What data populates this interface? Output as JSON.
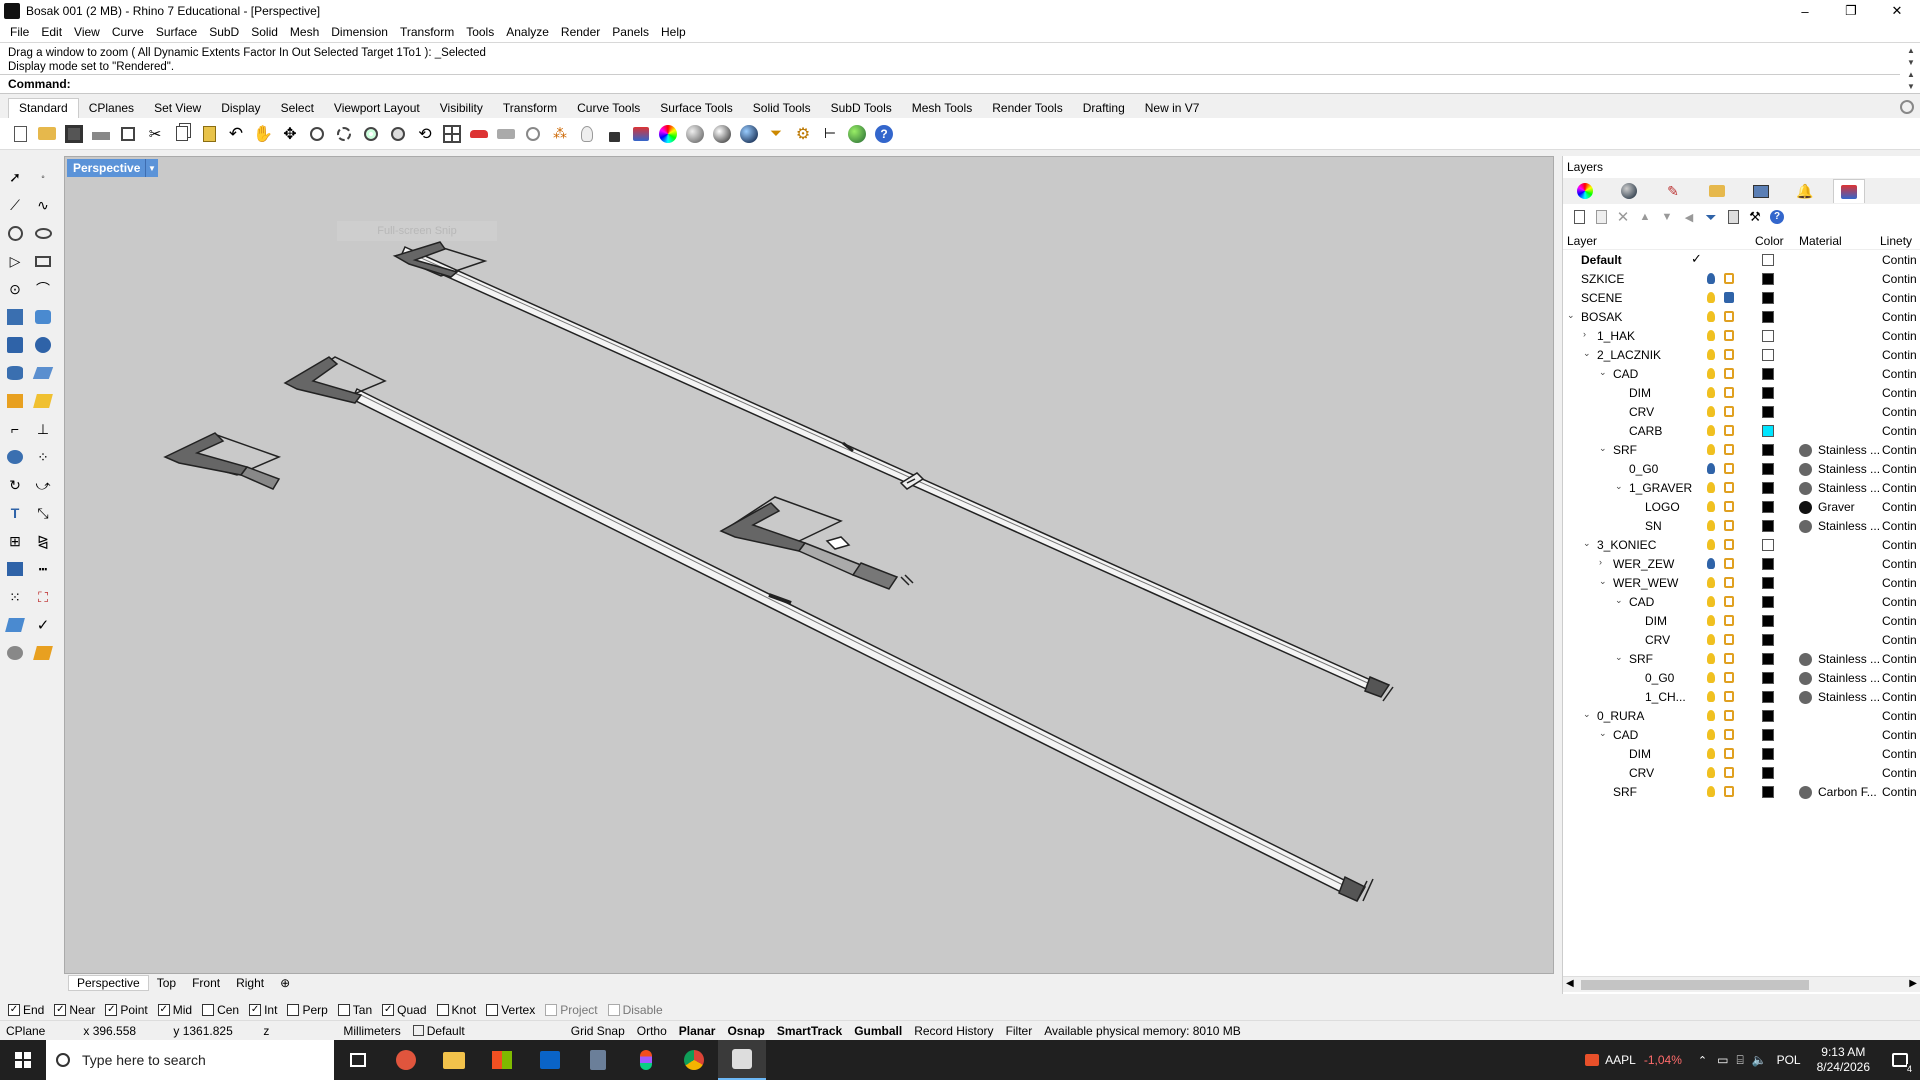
{
  "window": {
    "title": "Bosak 001 (2 MB) - Rhino 7 Educational - [Perspective]",
    "minimize": "–",
    "maximize": "❐",
    "close": "✕"
  },
  "menu": [
    "File",
    "Edit",
    "View",
    "Curve",
    "Surface",
    "SubD",
    "Solid",
    "Mesh",
    "Dimension",
    "Transform",
    "Tools",
    "Analyze",
    "Render",
    "Panels",
    "Help"
  ],
  "command": {
    "history_1": "Drag a window to zoom ( All  Dynamic  Extents  Factor  In  Out  Selected  Target  1To1 ): _Selected",
    "history_2": "Display mode set to \"Rendered\".",
    "prompt": "Command:",
    "value": ""
  },
  "toolbar_tabs": [
    "Standard",
    "CPlanes",
    "Set View",
    "Display",
    "Select",
    "Viewport Layout",
    "Visibility",
    "Transform",
    "Curve Tools",
    "Surface Tools",
    "Solid Tools",
    "SubD Tools",
    "Mesh Tools",
    "Render Tools",
    "Drafting",
    "New in V7"
  ],
  "viewport": {
    "name": "Perspective",
    "overlay_text": "Full-screen Snip"
  },
  "viewport_tabs": [
    "Perspective",
    "Top",
    "Front",
    "Right",
    "⊕"
  ],
  "osnaps": [
    {
      "label": "End",
      "checked": true
    },
    {
      "label": "Near",
      "checked": true
    },
    {
      "label": "Point",
      "checked": true
    },
    {
      "label": "Mid",
      "checked": true
    },
    {
      "label": "Cen",
      "checked": false
    },
    {
      "label": "Int",
      "checked": true
    },
    {
      "label": "Perp",
      "checked": false
    },
    {
      "label": "Tan",
      "checked": false
    },
    {
      "label": "Quad",
      "checked": true
    },
    {
      "label": "Knot",
      "checked": false
    },
    {
      "label": "Vertex",
      "checked": false
    },
    {
      "label": "Project",
      "checked": false,
      "dim": true
    },
    {
      "label": "Disable",
      "checked": false,
      "dim": true
    }
  ],
  "status": {
    "cplane": "CPlane",
    "x": "x 396.558",
    "y": "y 1361.825",
    "z": "z",
    "units": "Millimeters",
    "layer": "Default",
    "grid_snap": "Grid Snap",
    "ortho": "Ortho",
    "planar": "Planar",
    "osnap": "Osnap",
    "smarttrack": "SmartTrack",
    "gumball": "Gumball",
    "record_history": "Record History",
    "filter": "Filter",
    "memory": "Available physical memory: 8010 MB"
  },
  "layers_panel": {
    "title": "Layers",
    "headers": {
      "layer": "Layer",
      "color": "Color",
      "material": "Material",
      "linetype": "Linety"
    },
    "rows": [
      {
        "name": "Default",
        "indent": 0,
        "arrow": "",
        "bold": true,
        "current": true,
        "color": "#ffffff",
        "material": "",
        "matcolor": "",
        "linetype": "Contin"
      },
      {
        "name": "SZKICE",
        "indent": 0,
        "arrow": "",
        "color": "#000000",
        "material": "",
        "matcolor": "",
        "linetype": "Contin",
        "bulb": "blue"
      },
      {
        "name": "SCENE",
        "indent": 0,
        "arrow": "",
        "color": "#000000",
        "material": "",
        "matcolor": "",
        "linetype": "Contin",
        "lock": "locked"
      },
      {
        "name": "BOSAK",
        "indent": 0,
        "arrow": "down",
        "color": "#000000",
        "material": "",
        "matcolor": "",
        "linetype": "Contin"
      },
      {
        "name": "1_HAK",
        "indent": 1,
        "arrow": "right",
        "color": "#ffffff",
        "material": "",
        "matcolor": "",
        "linetype": "Contin"
      },
      {
        "name": "2_LACZNIK",
        "indent": 1,
        "arrow": "down",
        "color": "#ffffff",
        "material": "",
        "matcolor": "",
        "linetype": "Contin"
      },
      {
        "name": "CAD",
        "indent": 2,
        "arrow": "down",
        "color": "#000000",
        "material": "",
        "matcolor": "",
        "linetype": "Contin"
      },
      {
        "name": "DIM",
        "indent": 3,
        "arrow": "",
        "color": "#000000",
        "material": "",
        "matcolor": "",
        "linetype": "Contin"
      },
      {
        "name": "CRV",
        "indent": 3,
        "arrow": "",
        "color": "#000000",
        "material": "",
        "matcolor": "",
        "linetype": "Contin"
      },
      {
        "name": "CARB",
        "indent": 3,
        "arrow": "",
        "color": "#00e5ff",
        "material": "",
        "matcolor": "",
        "linetype": "Contin"
      },
      {
        "name": "SRF",
        "indent": 2,
        "arrow": "down",
        "color": "#000000",
        "material": "Stainless ...",
        "matcolor": "#666666",
        "linetype": "Contin"
      },
      {
        "name": "0_G0",
        "indent": 3,
        "arrow": "",
        "color": "#000000",
        "material": "Stainless ...",
        "matcolor": "#666666",
        "linetype": "Contin",
        "bulb": "blue"
      },
      {
        "name": "1_GRAVER",
        "indent": 3,
        "arrow": "down",
        "color": "#000000",
        "material": "Stainless ...",
        "matcolor": "#666666",
        "linetype": "Contin"
      },
      {
        "name": "LOGO",
        "indent": 4,
        "arrow": "",
        "color": "#000000",
        "material": "Graver",
        "matcolor": "#111111",
        "linetype": "Contin"
      },
      {
        "name": "SN",
        "indent": 4,
        "arrow": "",
        "color": "#000000",
        "material": "Stainless ...",
        "matcolor": "#666666",
        "linetype": "Contin"
      },
      {
        "name": "3_KONIEC",
        "indent": 1,
        "arrow": "down",
        "color": "#ffffff",
        "material": "",
        "matcolor": "",
        "linetype": "Contin"
      },
      {
        "name": "WER_ZEW",
        "indent": 2,
        "arrow": "right",
        "color": "#000000",
        "material": "",
        "matcolor": "",
        "linetype": "Contin",
        "bulb": "blue"
      },
      {
        "name": "WER_WEW",
        "indent": 2,
        "arrow": "down",
        "color": "#000000",
        "material": "",
        "matcolor": "",
        "linetype": "Contin"
      },
      {
        "name": "CAD",
        "indent": 3,
        "arrow": "down",
        "color": "#000000",
        "material": "",
        "matcolor": "",
        "linetype": "Contin"
      },
      {
        "name": "DIM",
        "indent": 4,
        "arrow": "",
        "color": "#000000",
        "material": "",
        "matcolor": "",
        "linetype": "Contin"
      },
      {
        "name": "CRV",
        "indent": 4,
        "arrow": "",
        "color": "#000000",
        "material": "",
        "matcolor": "",
        "linetype": "Contin"
      },
      {
        "name": "SRF",
        "indent": 3,
        "arrow": "down",
        "color": "#000000",
        "material": "Stainless ...",
        "matcolor": "#666666",
        "linetype": "Contin"
      },
      {
        "name": "0_G0",
        "indent": 4,
        "arrow": "",
        "color": "#000000",
        "material": "Stainless ...",
        "matcolor": "#666666",
        "linetype": "Contin"
      },
      {
        "name": "1_CH...",
        "indent": 4,
        "arrow": "",
        "color": "#000000",
        "material": "Stainless ...",
        "matcolor": "#666666",
        "linetype": "Contin"
      },
      {
        "name": "0_RURA",
        "indent": 1,
        "arrow": "down",
        "color": "#000000",
        "material": "",
        "matcolor": "",
        "linetype": "Contin"
      },
      {
        "name": "CAD",
        "indent": 2,
        "arrow": "down",
        "color": "#000000",
        "material": "",
        "matcolor": "",
        "linetype": "Contin"
      },
      {
        "name": "DIM",
        "indent": 3,
        "arrow": "",
        "color": "#000000",
        "material": "",
        "matcolor": "",
        "linetype": "Contin"
      },
      {
        "name": "CRV",
        "indent": 3,
        "arrow": "",
        "color": "#000000",
        "material": "",
        "matcolor": "",
        "linetype": "Contin"
      },
      {
        "name": "SRF",
        "indent": 2,
        "arrow": "",
        "color": "#000000",
        "material": "Carbon F...",
        "matcolor": "#666666",
        "linetype": "Contin"
      }
    ]
  },
  "taskbar": {
    "search_placeholder": "Type here to search",
    "stock_symbol": "AAPL",
    "stock_change": "-1,04%",
    "language": "POL",
    "time": "9:13 AM",
    "date": "8/24/2026",
    "notification_count": "4"
  }
}
